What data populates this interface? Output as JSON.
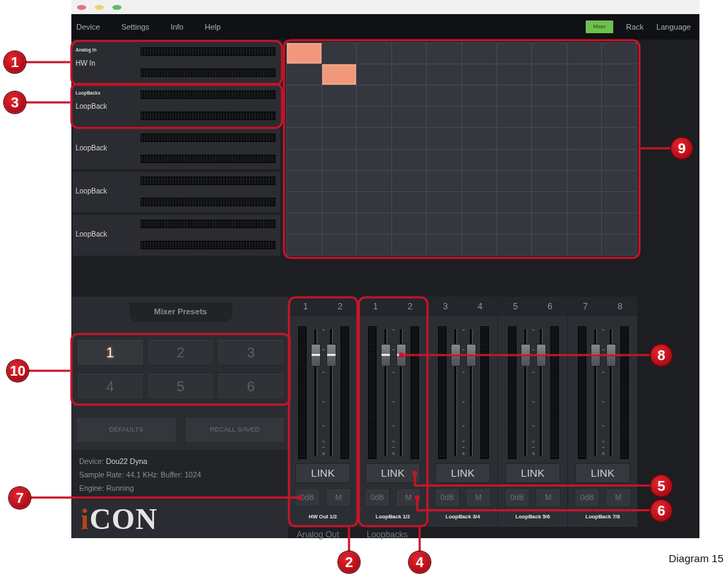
{
  "window": {
    "menus": [
      "Device",
      "Settings",
      "Info",
      "Help"
    ],
    "views": [
      {
        "label": "Mixer",
        "selected": true
      },
      {
        "label": "Rack",
        "selected": false
      },
      {
        "label": "Language",
        "selected": false
      }
    ]
  },
  "inputs": [
    {
      "group": "Analog In",
      "name": "HW In"
    },
    {
      "group": "LoopBacks",
      "name": "LoopBack"
    },
    {
      "name": "LoopBack"
    },
    {
      "name": "LoopBack"
    },
    {
      "name": "LoopBack"
    }
  ],
  "matrix": {
    "rows": [
      [
        {
          "on": true
        },
        {
          "on": false
        },
        {
          "on": false
        },
        {
          "on": false
        },
        {
          "on": false
        },
        {
          "on": false
        },
        {
          "on": false
        },
        {
          "on": false
        },
        {
          "on": false
        },
        {
          "on": false
        }
      ],
      [
        {
          "on": false
        },
        {
          "on": true
        },
        {
          "on": false
        },
        {
          "on": false
        },
        {
          "on": false
        },
        {
          "on": false
        },
        {
          "on": false
        },
        {
          "on": false
        },
        {
          "on": false
        },
        {
          "on": false
        }
      ],
      [
        {
          "on": false
        },
        {
          "on": false
        },
        {
          "on": false
        },
        {
          "on": false
        },
        {
          "on": false
        },
        {
          "on": false
        },
        {
          "on": false
        },
        {
          "on": false
        },
        {
          "on": false
        },
        {
          "on": false
        }
      ],
      [
        {
          "on": false
        },
        {
          "on": false
        },
        {
          "on": false
        },
        {
          "on": false
        },
        {
          "on": false
        },
        {
          "on": false
        },
        {
          "on": false
        },
        {
          "on": false
        },
        {
          "on": false
        },
        {
          "on": false
        }
      ],
      [
        {
          "on": false
        },
        {
          "on": false
        },
        {
          "on": false
        },
        {
          "on": false
        },
        {
          "on": false
        },
        {
          "on": false
        },
        {
          "on": false
        },
        {
          "on": false
        },
        {
          "on": false
        },
        {
          "on": false
        }
      ],
      [
        {
          "on": false
        },
        {
          "on": false
        },
        {
          "on": false
        },
        {
          "on": false
        },
        {
          "on": false
        },
        {
          "on": false
        },
        {
          "on": false
        },
        {
          "on": false
        },
        {
          "on": false
        },
        {
          "on": false
        }
      ],
      [
        {
          "on": false
        },
        {
          "on": false
        },
        {
          "on": false
        },
        {
          "on": false
        },
        {
          "on": false
        },
        {
          "on": false
        },
        {
          "on": false
        },
        {
          "on": false
        },
        {
          "on": false
        },
        {
          "on": false
        }
      ],
      [
        {
          "on": false
        },
        {
          "on": false
        },
        {
          "on": false
        },
        {
          "on": false
        },
        {
          "on": false
        },
        {
          "on": false
        },
        {
          "on": false
        },
        {
          "on": false
        },
        {
          "on": false
        },
        {
          "on": false
        }
      ],
      [
        {
          "on": false
        },
        {
          "on": false
        },
        {
          "on": false
        },
        {
          "on": false
        },
        {
          "on": false
        },
        {
          "on": false
        },
        {
          "on": false
        },
        {
          "on": false
        },
        {
          "on": false
        },
        {
          "on": false
        }
      ],
      [
        {
          "on": false
        },
        {
          "on": false
        },
        {
          "on": false
        },
        {
          "on": false
        },
        {
          "on": false
        },
        {
          "on": false
        },
        {
          "on": false
        },
        {
          "on": false
        },
        {
          "on": false
        },
        {
          "on": false
        }
      ]
    ]
  },
  "presets": {
    "title": "Mixer Presets",
    "slots": [
      {
        "label": "1",
        "selected": true
      },
      {
        "label": "2",
        "selected": false
      },
      {
        "label": "3",
        "selected": false
      },
      {
        "label": "4",
        "selected": false
      },
      {
        "label": "5",
        "selected": false
      },
      {
        "label": "6",
        "selected": false
      }
    ],
    "actions": [
      "DEFAULTS",
      "RECALL SAVED"
    ]
  },
  "device_info": {
    "device_label": "Device:",
    "device": "Dou22 Dyna",
    "lines": [
      "Sample Rate: 44.1 KHz: Buffer: 1024",
      "Engine: Running"
    ]
  },
  "logo": "iCON",
  "output_groups": [
    {
      "label": "Analog Out",
      "strips": [
        {
          "channels": [
            "1",
            "2"
          ],
          "faders": [
            {
              "level": 0.86
            },
            {
              "level": 0.86
            }
          ],
          "link": "LINK",
          "gain": "0dB",
          "mute": "M",
          "name": "HW Out 1/2"
        }
      ]
    },
    {
      "label": "Loopbacks",
      "strips": [
        {
          "channels": [
            "1",
            "2"
          ],
          "faders": [
            {
              "level": 0.86
            },
            {
              "level": 0.86
            }
          ],
          "link": "LINK",
          "gain": "0dB",
          "mute": "M",
          "name": "LoopBack 1/2"
        },
        {
          "channels": [
            "3",
            "4"
          ],
          "faders": [
            {
              "level": 0.86
            },
            {
              "level": 0.86
            }
          ],
          "link": "LINK",
          "gain": "0dB",
          "mute": "M",
          "name": "LoopBack 3/4"
        },
        {
          "channels": [
            "5",
            "6"
          ],
          "faders": [
            {
              "level": 0.86
            },
            {
              "level": 0.86
            }
          ],
          "link": "LINK",
          "gain": "0dB",
          "mute": "M",
          "name": "LoopBack 5/6"
        },
        {
          "channels": [
            "7",
            "8"
          ],
          "faders": [
            {
              "level": 0.86
            },
            {
              "level": 0.86
            }
          ],
          "link": "LINK",
          "gain": "0dB",
          "mute": "M",
          "name": "LoopBack 7/8"
        }
      ]
    }
  ],
  "callouts": [
    {
      "number": "1",
      "kind": "frame"
    },
    {
      "number": "3",
      "kind": "frame"
    },
    {
      "number": "9",
      "kind": "frame"
    },
    {
      "number": "10",
      "kind": "frame"
    },
    {
      "number": "8",
      "kind": "pointer"
    },
    {
      "number": "5",
      "kind": "pointer"
    },
    {
      "number": "7",
      "kind": "pointer"
    },
    {
      "number": "6",
      "kind": "pointer"
    },
    {
      "number": "2",
      "kind": "frame"
    },
    {
      "number": "4",
      "kind": "frame"
    }
  ],
  "caption": "Diagram 15"
}
